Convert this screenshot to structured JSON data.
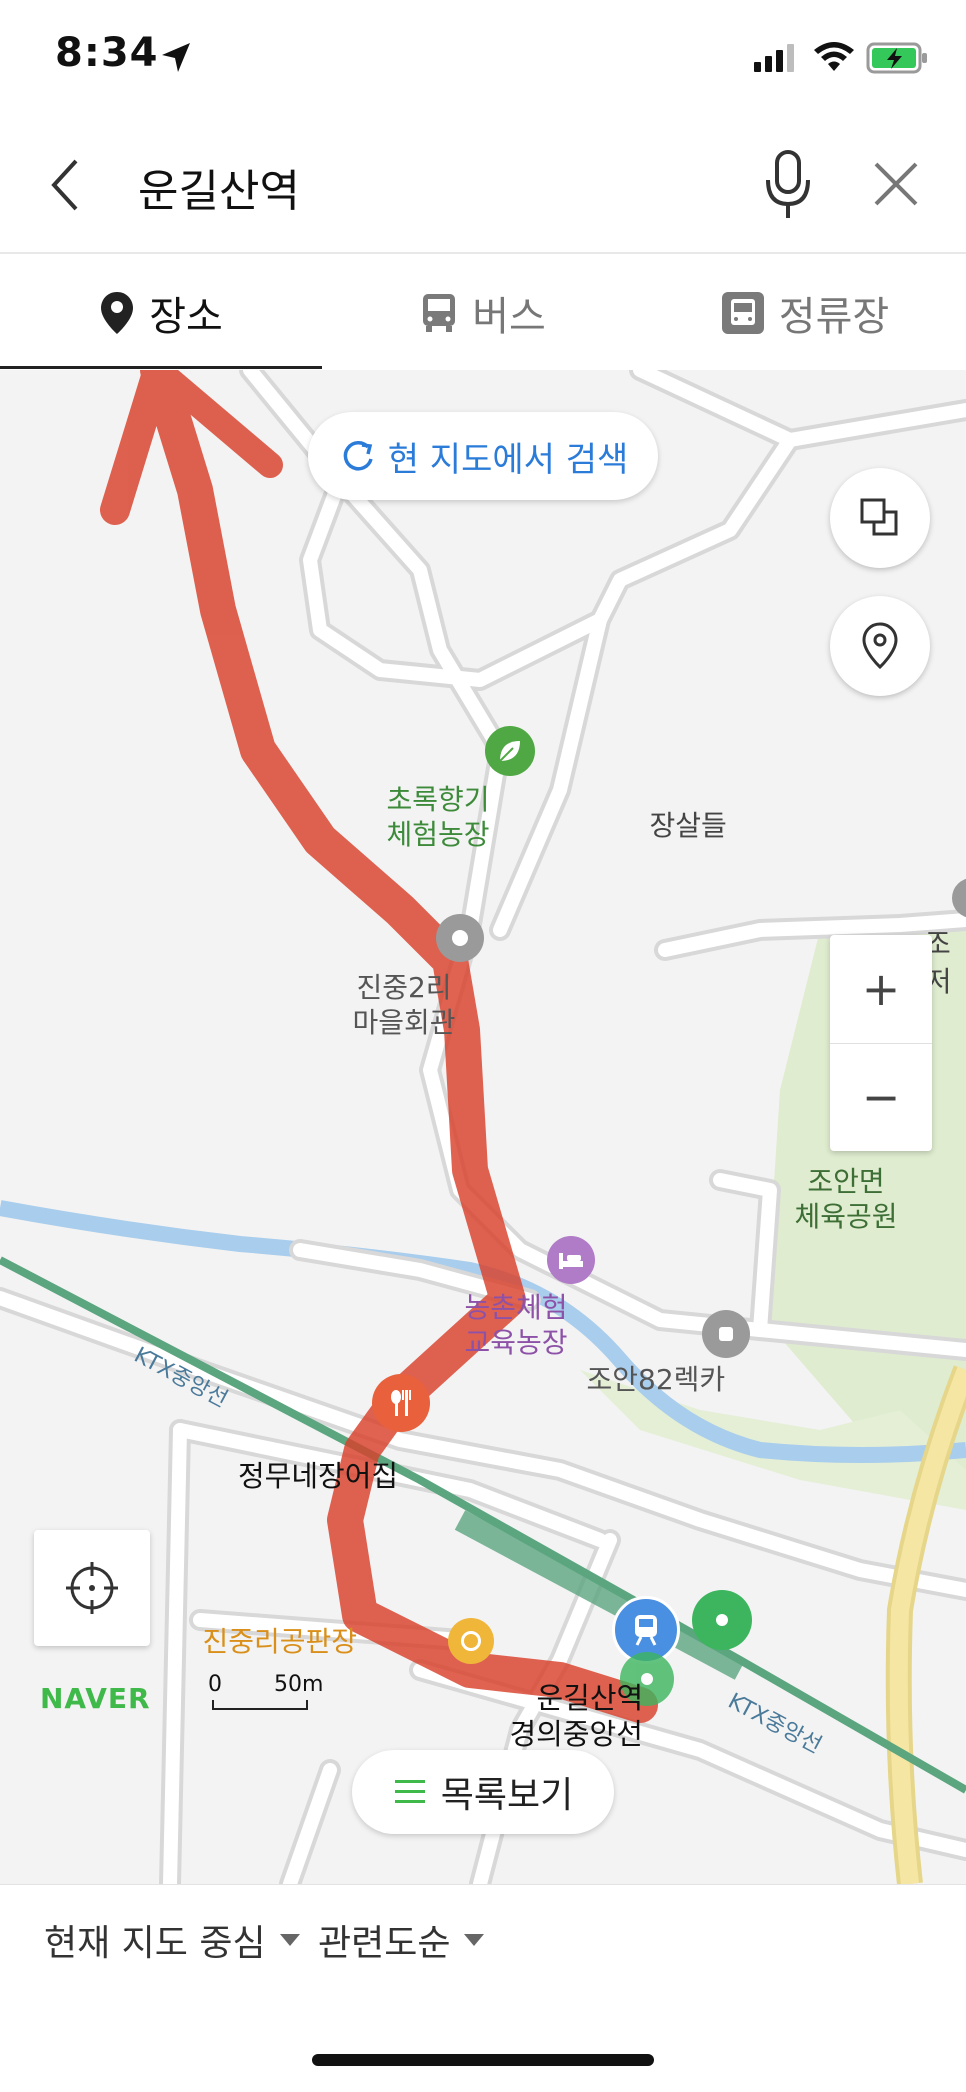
{
  "status_bar": {
    "time": "8:34"
  },
  "search": {
    "query": "운길산역"
  },
  "tabs": [
    {
      "label": "장소",
      "icon": "map-pin-icon",
      "active": true
    },
    {
      "label": "버스",
      "icon": "bus-icon",
      "active": false
    },
    {
      "label": "정류장",
      "icon": "bus-stop-icon",
      "active": false
    }
  ],
  "map": {
    "search_here_label": "현 지도에서 검색",
    "labels": {
      "farm_experience": "초록향기\n체험농장",
      "jangsaldeul": "장살들",
      "village_hall": "진중2리\n마을회관",
      "sports_park": "조안면\n체육공원",
      "rural_farm": "농촌체험\n교육농장",
      "rentcar": "조안82렉카",
      "restaurant": "정무네장어집",
      "factory": "진중리공판장",
      "station": "운길산역",
      "line": "경의중앙선",
      "ktx_upper": "KTX중앙선",
      "ktx_lower": "KTX중앙선",
      "partial_right_1": "조",
      "partial_right_2": "민저"
    },
    "scale": {
      "zero": "0",
      "length": "50m"
    },
    "logo": "NAVER",
    "list_label": "목록보기",
    "zoom_in": "+",
    "zoom_out": "−"
  },
  "bottom_bar": {
    "sort_center": "현재 지도 중심",
    "sort_relevance": "관련도순"
  },
  "colors": {
    "accent_blue": "#2b7bd8",
    "naver_green": "#3fb949",
    "annotation_red": "#d9412c",
    "park_green": "#dfeccf",
    "river_blue": "#a9cdec",
    "rail_green": "#5ba57f",
    "highway_yellow": "#f6e6a3"
  }
}
